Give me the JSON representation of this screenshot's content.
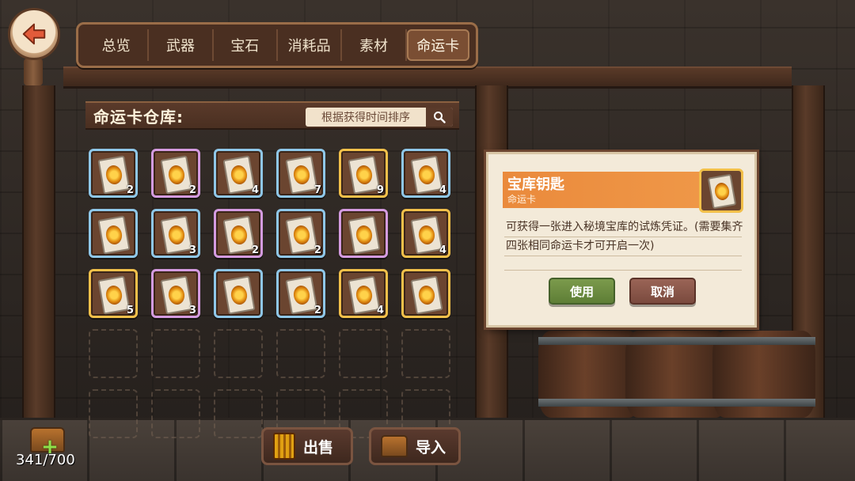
{
  "back_button": {
    "icon": "back-arrow-icon",
    "accent": "#e25b3a"
  },
  "tabs": [
    {
      "label": "总览",
      "active": false
    },
    {
      "label": "武器",
      "active": false
    },
    {
      "label": "宝石",
      "active": false
    },
    {
      "label": "消耗品",
      "active": false
    },
    {
      "label": "素材",
      "active": false
    },
    {
      "label": "命运卡",
      "active": true
    }
  ],
  "warehouse": {
    "title": "命运卡仓库:",
    "sort_label": "根据获得时间排序",
    "search_icon": "search-icon"
  },
  "inventory": {
    "items": [
      {
        "rarity": "blue",
        "count": "2"
      },
      {
        "rarity": "purple",
        "count": "2"
      },
      {
        "rarity": "blue",
        "count": "4"
      },
      {
        "rarity": "blue",
        "count": "7"
      },
      {
        "rarity": "gold",
        "count": "9"
      },
      {
        "rarity": "blue",
        "count": "4"
      },
      {
        "rarity": "blue",
        "count": ""
      },
      {
        "rarity": "blue",
        "count": "3"
      },
      {
        "rarity": "purple",
        "count": "2"
      },
      {
        "rarity": "blue",
        "count": "2"
      },
      {
        "rarity": "purple",
        "count": ""
      },
      {
        "rarity": "gold",
        "count": "4"
      },
      {
        "rarity": "gold",
        "count": "5"
      },
      {
        "rarity": "purple",
        "count": "3"
      },
      {
        "rarity": "blue",
        "count": ""
      },
      {
        "rarity": "blue",
        "count": "2"
      },
      {
        "rarity": "gold",
        "count": "4"
      },
      {
        "rarity": "gold",
        "count": ""
      }
    ],
    "empty_slots": 12,
    "rarity_colors": {
      "blue": "#8fc7e8",
      "purple": "#d49be0",
      "gold": "#f2c04a"
    }
  },
  "detail": {
    "name": "宝库钥匙",
    "type": "命运卡",
    "description": "可获得一张进入秘境宝库的试炼凭证。(需要集齐四张相同命运卡才可开启一次)",
    "use_label": "使用",
    "cancel_label": "取消",
    "header_color": "#ea8a3c"
  },
  "bottom": {
    "capacity": "341/700",
    "sell_label": "出售",
    "import_label": "导入"
  }
}
